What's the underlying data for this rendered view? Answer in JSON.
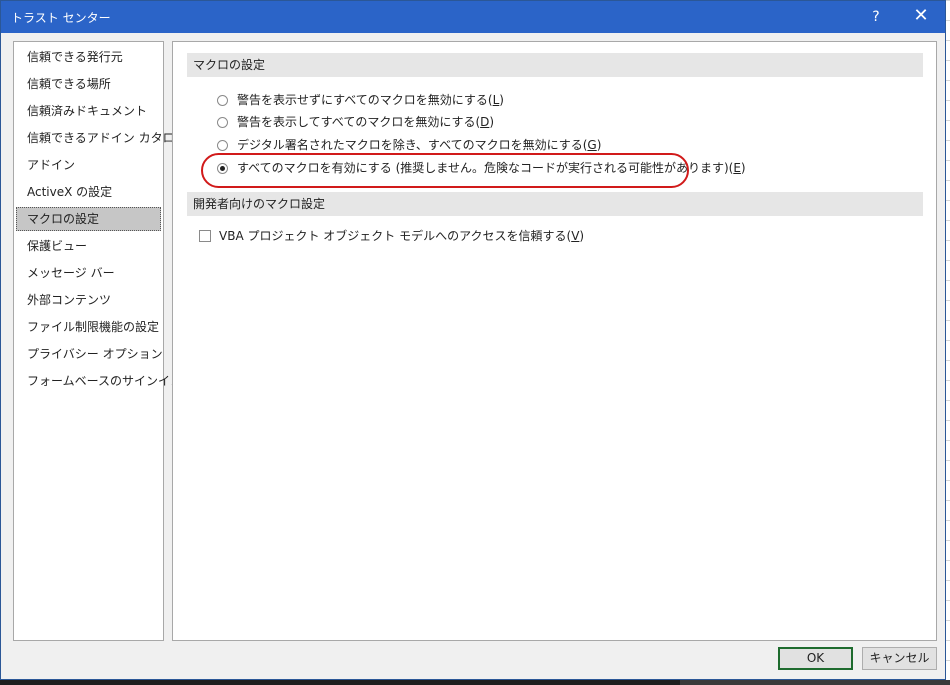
{
  "window": {
    "title": "トラスト センター",
    "help_label": "?",
    "close_label": "✕"
  },
  "sidebar": {
    "items": [
      {
        "label": "信頼できる発行元"
      },
      {
        "label": "信頼できる場所"
      },
      {
        "label": "信頼済みドキュメント"
      },
      {
        "label": "信頼できるアドイン カタログ"
      },
      {
        "label": "アドイン"
      },
      {
        "label": "ActiveX の設定"
      },
      {
        "label": "マクロの設定",
        "selected": true
      },
      {
        "label": "保護ビュー"
      },
      {
        "label": "メッセージ バー"
      },
      {
        "label": "外部コンテンツ"
      },
      {
        "label": "ファイル制限機能の設定"
      },
      {
        "label": "プライバシー オプション"
      },
      {
        "label": "フォームベースのサインイン"
      }
    ]
  },
  "macro_settings": {
    "header": "マクロの設定",
    "options": [
      {
        "text": "警告を表示せずにすべてのマクロを無効にする(",
        "key": "L",
        "end": ")",
        "checked": false
      },
      {
        "text": "警告を表示してすべてのマクロを無効にする(",
        "key": "D",
        "end": ")",
        "checked": false
      },
      {
        "text": "デジタル署名されたマクロを除き、すべてのマクロを無効にする(",
        "key": "G",
        "end": ")",
        "checked": false
      },
      {
        "text": "すべてのマクロを有効にする (推奨しません。危険なコードが実行される可能性があります)(",
        "key": "E",
        "end": ")",
        "checked": true
      }
    ]
  },
  "developer_settings": {
    "header": "開発者向けのマクロ設定",
    "vba_access": {
      "text": "VBA プロジェクト オブジェクト モデルへのアクセスを信頼する(",
      "key": "V",
      "end": ")",
      "checked": false
    }
  },
  "buttons": {
    "ok": "OK",
    "cancel": "キャンセル"
  },
  "colors": {
    "titlebar": "#2b64c8",
    "highlight_ellipse": "#d11a1a",
    "ok_border": "#1e6b2e"
  }
}
